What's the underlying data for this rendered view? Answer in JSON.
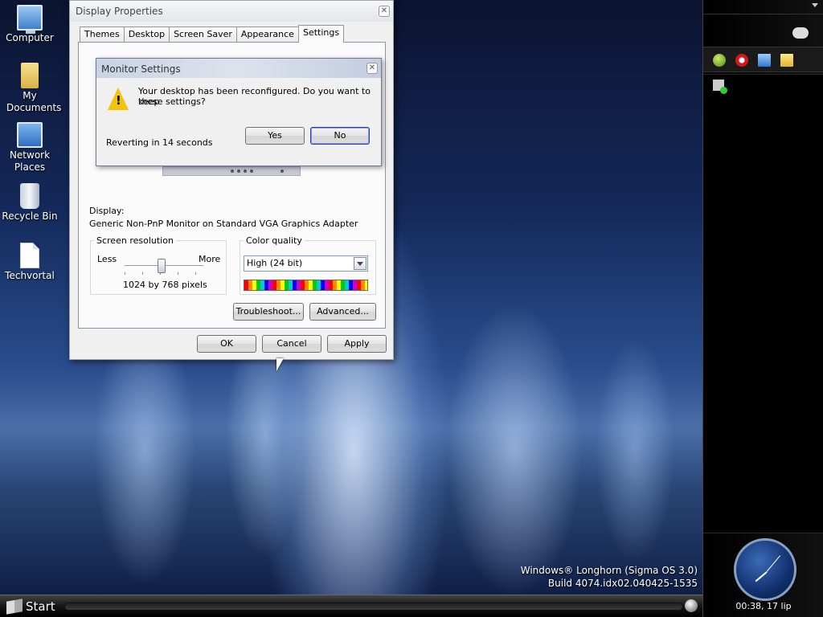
{
  "desktop": {
    "icons": [
      {
        "label": "Computer",
        "icon": "computer-icon"
      },
      {
        "label": "My Documents",
        "icon": "documents-folder-icon"
      },
      {
        "label": "Network Places",
        "icon": "network-icon"
      },
      {
        "label": "Recycle Bin",
        "icon": "recycle-bin-icon"
      },
      {
        "label": "Techvortal",
        "icon": "file-icon"
      }
    ],
    "build_line1": "Windows® Longhorn (Sigma OS 3.0)",
    "build_line2": "Build 4074.idx02.040425-1535"
  },
  "window": {
    "title": "Display Properties",
    "tabs": [
      "Themes",
      "Desktop",
      "Screen Saver",
      "Appearance",
      "Settings"
    ],
    "active_tab": "Settings",
    "display_label": "Display:",
    "display_value": "Generic Non-PnP Monitor on Standard VGA Graphics Adapter",
    "resolution": {
      "legend": "Screen resolution",
      "less": "Less",
      "more": "More",
      "value": "1024 by 768 pixels"
    },
    "color": {
      "legend": "Color quality",
      "selected": "High (24 bit)"
    },
    "troubleshoot_label": "Troubleshoot...",
    "advanced_label": "Advanced...",
    "ok_label": "OK",
    "cancel_label": "Cancel",
    "apply_label": "Apply"
  },
  "dialog": {
    "title": "Monitor Settings",
    "message_line1": "Your desktop has been reconfigured.  Do you want to keep",
    "message_line2": "these settings?",
    "countdown": "Reverting in 14 seconds",
    "yes_label": "Yes",
    "no_label": "No"
  },
  "taskbar": {
    "start_label": "Start"
  },
  "sidebar": {
    "clock_text": "00:38, 17 lip"
  },
  "colors": {
    "accent": "#2b3f9a",
    "warning": "#f4c400"
  }
}
